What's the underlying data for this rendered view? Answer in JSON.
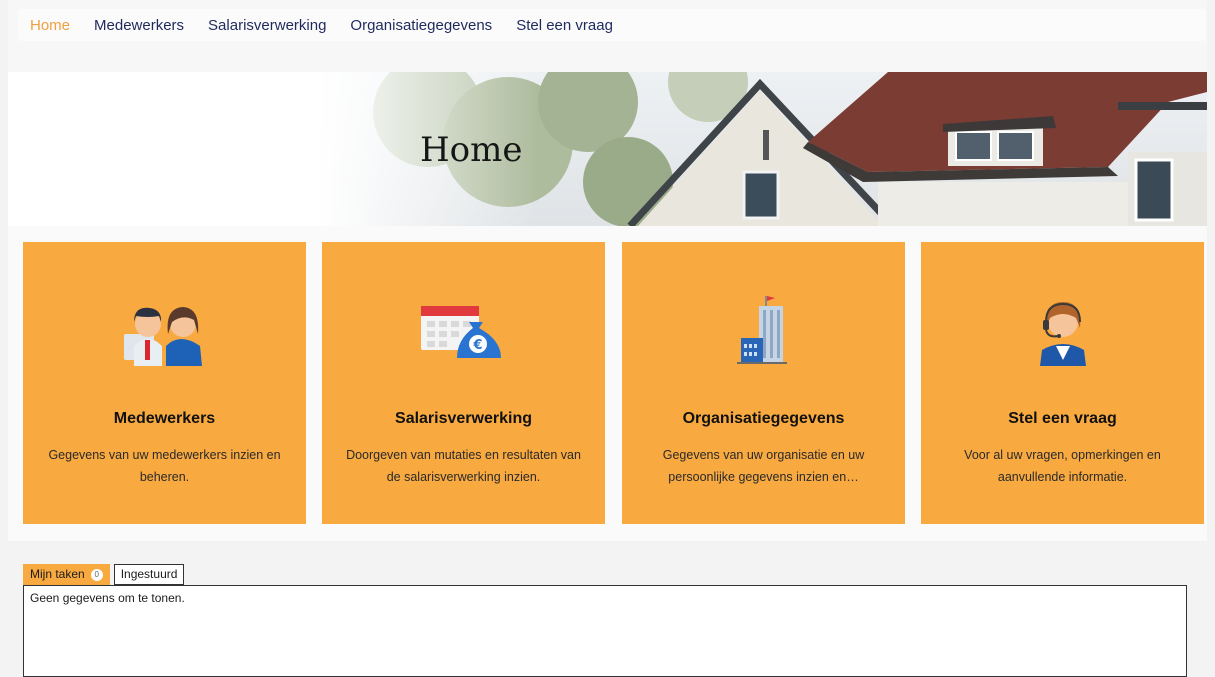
{
  "nav": {
    "items": [
      {
        "label": "Home",
        "active": true
      },
      {
        "label": "Medewerkers",
        "active": false
      },
      {
        "label": "Salarisverwerking",
        "active": false
      },
      {
        "label": "Organisatiegegevens",
        "active": false
      },
      {
        "label": "Stel een vraag",
        "active": false
      }
    ]
  },
  "hero": {
    "title": "Home"
  },
  "cards": [
    {
      "icon": "people-icon",
      "title": "Medewerkers",
      "description": "Gegevens van uw medewerkers inzien en beheren."
    },
    {
      "icon": "payroll-calendar-money-icon",
      "title": "Salarisverwerking",
      "description": "Doorgeven van mutaties en resultaten van de salarisverwerking inzien."
    },
    {
      "icon": "office-building-icon",
      "title": "Organisatiegegevens",
      "description": "Gegevens van uw organisatie en uw persoonlijke gegevens inzien en…"
    },
    {
      "icon": "support-agent-headset-icon",
      "title": "Stel een vraag",
      "description": "Voor al uw vragen, opmerkingen en aanvullende informatie."
    }
  ],
  "tasks": {
    "tabs": [
      {
        "label": "Mijn taken",
        "count": "0",
        "active": true
      },
      {
        "label": "Ingestuurd",
        "active": false
      }
    ],
    "empty_message": "Geen gegevens om te tonen."
  },
  "colors": {
    "accent": "#f8a940",
    "nav_active": "#f0a040",
    "nav_text": "#1f2a5c"
  }
}
